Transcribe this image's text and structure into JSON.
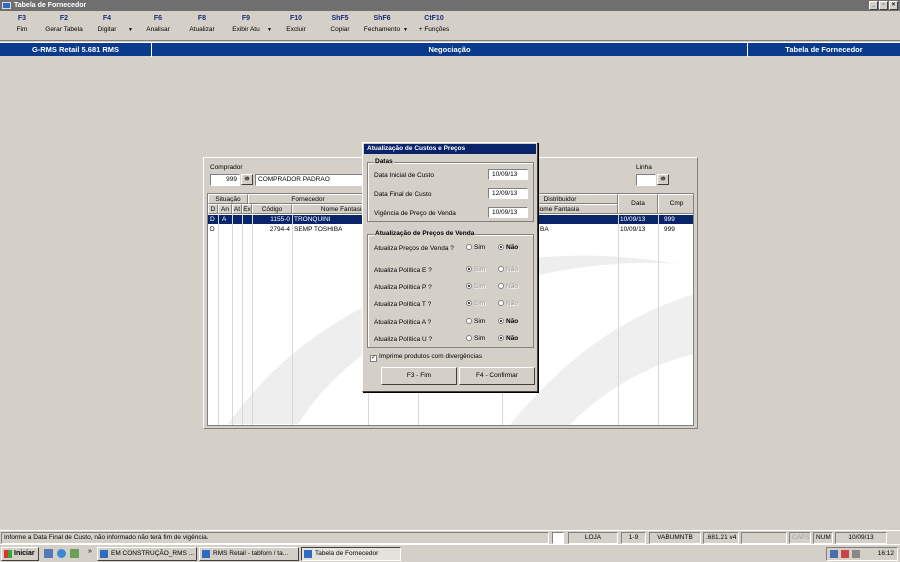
{
  "window": {
    "title": "Tabela de Fornecedor"
  },
  "toolbar": [
    {
      "key": "F3",
      "label": "Fim"
    },
    {
      "key": "F2",
      "label": "Gerar Tabela"
    },
    {
      "key": "F4",
      "label": "Digitar"
    },
    {
      "key": "F6",
      "label": "Analisar"
    },
    {
      "key": "F8",
      "label": "Atualizar"
    },
    {
      "key": "F9",
      "label": "Exibir Atu"
    },
    {
      "key": "F10",
      "label": "Excluir"
    },
    {
      "key": "ShF5",
      "label": "Copiar"
    },
    {
      "key": "ShF6",
      "label": "Fechamento"
    },
    {
      "key": "CtF10",
      "label": "+ Funções"
    }
  ],
  "header": {
    "left": "G-RMS Retail 5.681 RMS",
    "center": "Negociação",
    "right": "Tabela de Fornecedor"
  },
  "panel": {
    "comprador_label": "Comprador",
    "comprador_code": "999",
    "comprador_name": "COMPRADOR PADRAO",
    "linha_label": "Linha",
    "grid_headers": {
      "situacao": "Situação",
      "fornecedor": "Fornecedor",
      "distribuidor": "Distribuidor",
      "d": "D",
      "an": "An",
      "at": "At",
      "ex": "Ex",
      "codigo": "Código",
      "nome_fantasia_forn": "Nome Fantasia",
      "nome_fantasia_dist": "Nome Fantasia",
      "data": "Data",
      "cmp": "Cmp"
    },
    "rows": [
      {
        "d": "D",
        "an": "A",
        "at": "",
        "ex": "",
        "codigo": "1155-0",
        "nome": "TRONQUINI",
        "dist": "",
        "data": "10/09/13",
        "cmp": "999"
      },
      {
        "d": "D",
        "an": "",
        "at": "",
        "ex": "",
        "codigo": "2794-4",
        "nome": "SEMP TOSHIBA",
        "dist": "BA",
        "data": "10/09/13",
        "cmp": "999"
      }
    ]
  },
  "dialog": {
    "title": "Atualização de Custos e Preços",
    "datas_group": "Datas",
    "data_inicial_label": "Data Inicial de Custo",
    "data_inicial": "10/09/13",
    "data_final_label": "Data Final de Custo",
    "data_final": "12/09/13",
    "vigencia_label": "Vigência de Preço de Venda",
    "vigencia": "10/09/13",
    "precos_group": "Atualização de Preços de Venda",
    "options": [
      {
        "label": "Atualiza Preços de Venda ?",
        "value": "Não",
        "enabled": true
      },
      {
        "label": "Atualiza Política E ?",
        "value": "Sim",
        "enabled": false
      },
      {
        "label": "Atualiza Política P ?",
        "value": "Sim",
        "enabled": false
      },
      {
        "label": "Atualiza Política T ?",
        "value": "Sim",
        "enabled": false
      },
      {
        "label": "Atualiza Política A ?",
        "value": "Não",
        "enabled": true
      },
      {
        "label": "Atualiza Política U ?",
        "value": "Não",
        "enabled": true
      }
    ],
    "sim": "Sim",
    "nao": "Não",
    "imprime_label": "Imprime produtos com divergências",
    "imprime_checked": true,
    "btn_fim": "F3 - Fim",
    "btn_confirmar": "F4 - Confirmar"
  },
  "status": {
    "message": "Informe a Data Final de Custo, não informado não terá fim de vigência.",
    "loja": "LOJA",
    "range": "1-9",
    "user": "VABUMNTB",
    "version": ".681.21 v4",
    "caps": "CAPS",
    "num": "NUM",
    "date": "10/09/13"
  },
  "taskbar": {
    "start": "Iniciar",
    "tasks": [
      "EM CONSTRUÇÃO_RMS ...",
      "RMS Retail - tabforn / ta...",
      "Tabela de Fornecedor"
    ],
    "clock": "16:12"
  }
}
